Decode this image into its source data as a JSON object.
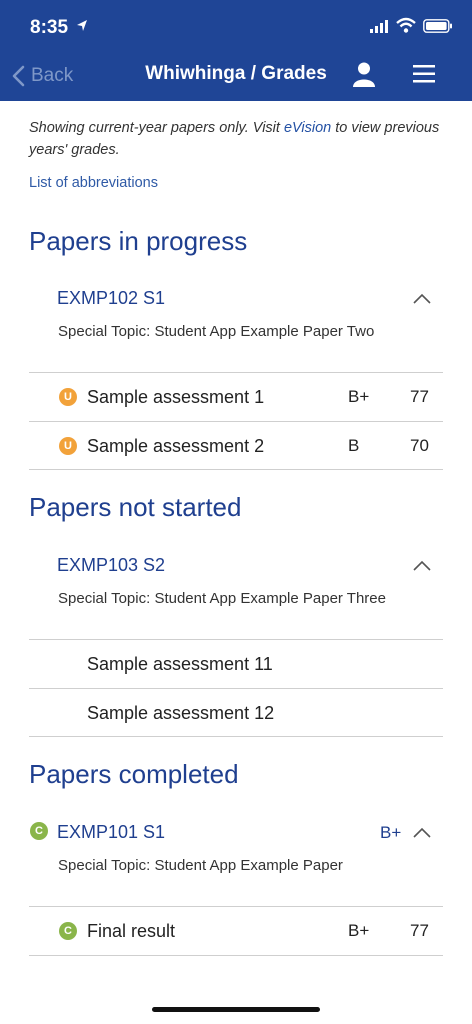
{
  "status_bar": {
    "time": "8:35"
  },
  "nav": {
    "back_label": "Back",
    "title": "Whiwhinga / Grades"
  },
  "intro": {
    "text_before": "Showing current-year papers only. Visit ",
    "link": "eVision",
    "text_after": " to view previous years' grades."
  },
  "abbreviations_link": "List of abbreviations",
  "sections": [
    {
      "title": "Papers in progress",
      "paper": {
        "code": "EXMP102 S1",
        "description": "Special Topic: Student App Example Paper Two"
      },
      "rows": [
        {
          "badge": "U",
          "label": "Sample assessment 1",
          "grade": "B+",
          "score": "77"
        },
        {
          "badge": "U",
          "label": "Sample assessment 2",
          "grade": "B",
          "score": "70"
        }
      ]
    },
    {
      "title": "Papers not started",
      "paper": {
        "code": "EXMP103 S2",
        "description": "Special Topic: Student App Example Paper Three"
      },
      "rows": [
        {
          "label": "Sample assessment 11"
        },
        {
          "label": "Sample assessment 12"
        }
      ]
    },
    {
      "title": "Papers completed",
      "paper": {
        "badge": "C",
        "code": "EXMP101 S1",
        "grade": "B+",
        "description": "Special Topic: Student App Example Paper"
      },
      "rows": [
        {
          "badge": "C",
          "label": "Final result",
          "grade": "B+",
          "score": "77"
        }
      ]
    }
  ],
  "colors": {
    "header": "#1f4596",
    "accent": "#1f3f8f",
    "badge_u": "#f2a23a",
    "badge_c": "#8ab54a"
  }
}
